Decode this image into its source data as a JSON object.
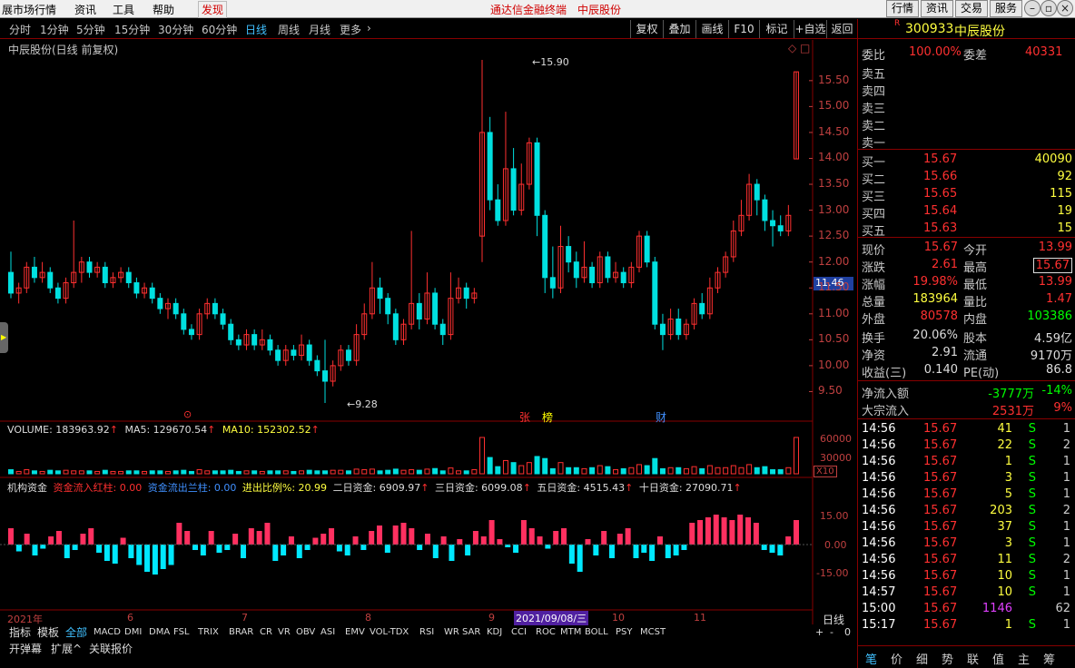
{
  "menu": {
    "market": "展市场行情",
    "info": "资讯",
    "tools": "工具",
    "help": "帮助",
    "discover": "发现",
    "title": "通达信金融终端",
    "stock": "中辰股份",
    "btns": [
      "行情",
      "资讯",
      "交易",
      "服务"
    ]
  },
  "periods": [
    "分时",
    "1分钟",
    "5分钟",
    "15分钟",
    "30分钟",
    "60分钟",
    "日线",
    "周线",
    "月线",
    "更多",
    "›"
  ],
  "tools": [
    "复权",
    "叠加",
    "画线",
    "F10",
    "标记",
    "+自选",
    "返回"
  ],
  "chart": {
    "title": "中辰股份(日线 前复权)",
    "high_label": "15.90",
    "low_label": "9.28",
    "cursor_price": "11.46",
    "ylabels": [
      "15.50",
      "15.00",
      "14.50",
      "14.00",
      "13.50",
      "13.00",
      "12.50",
      "12.00",
      "11.50",
      "11.00",
      "10.50",
      "10.00",
      "9.50"
    ],
    "markers": [
      {
        "t": "⊙",
        "c": "#ff3030"
      },
      {
        "t": "张",
        "c": "#ff3030"
      },
      {
        "t": "榜",
        "c": "#ffff00"
      },
      {
        "t": "财",
        "c": "#4090ff"
      }
    ]
  },
  "volume": {
    "label": "VOLUME: 183963.92",
    "ma5": "MA5: 129670.54",
    "ma10": "MA10: 152302.52",
    "y1": "60000",
    "y2": "30000",
    "unit": "X10"
  },
  "fund": {
    "label": "机构资金",
    "in": "资金流入红柱: 0.00",
    "out": "资金流出兰柱: 0.00",
    "ratio": "进出比例%: 20.99",
    "d2": "二日资金: 6909.97",
    "d3": "三日资金: 6099.08",
    "d5": "五日资金: 4515.43",
    "d10": "十日资金: 27090.71",
    "y1": "15.00",
    "y2": "0.00",
    "y3": "-15.00"
  },
  "xaxis": {
    "year": "2021年",
    "m6": "6",
    "m7": "7",
    "m8": "8",
    "m9": "9",
    "date": "2021/09/08/三",
    "m10": "10",
    "m11": "11",
    "period": "日线"
  },
  "indicators": [
    "指标",
    "模板",
    "全部",
    "MACD",
    "DMI",
    "DMA",
    "FSL",
    "TRIX",
    "BRAR",
    "CR",
    "VR",
    "OBV",
    "ASI",
    "EMV",
    "VOL-TDX",
    "RSI",
    "WR",
    "SAR",
    "KDJ",
    "CCI",
    "ROC",
    "MTM",
    "BOLL",
    "PSY",
    "MCST"
  ],
  "bottom2": [
    "开弹幕",
    "扩展^",
    "关联报价"
  ],
  "zoom": [
    "+",
    "-",
    "0"
  ],
  "quote": {
    "code": "300933",
    "name": "中辰股份",
    "wb": "委比",
    "wb_v": "100.00%",
    "wc": "委差",
    "wc_v": "40331",
    "sells": [
      "卖五",
      "卖四",
      "卖三",
      "卖二",
      "卖一"
    ],
    "buys": [
      {
        "l": "买一",
        "p": "15.67",
        "v": "40090"
      },
      {
        "l": "买二",
        "p": "15.66",
        "v": "92"
      },
      {
        "l": "买三",
        "p": "15.65",
        "v": "115"
      },
      {
        "l": "买四",
        "p": "15.64",
        "v": "19"
      },
      {
        "l": "买五",
        "p": "15.63",
        "v": "15"
      }
    ],
    "stats": [
      [
        "现价",
        "15.67",
        "今开",
        "13.99"
      ],
      [
        "涨跌",
        "2.61",
        "最高",
        "15.67"
      ],
      [
        "涨幅",
        "19.98%",
        "最低",
        "13.99"
      ],
      [
        "总量",
        "183964",
        "量比",
        "1.47"
      ],
      [
        "外盘",
        "80578",
        "内盘",
        "103386"
      ],
      [
        "换手",
        "20.06%",
        "股本",
        "4.59亿"
      ],
      [
        "净资",
        "2.91",
        "流通",
        "9170万"
      ],
      [
        "收益(三)",
        "0.140",
        "PE(动)",
        "86.8"
      ]
    ],
    "flow": [
      [
        "净流入额",
        "-3777万",
        "-14%"
      ],
      [
        "大宗流入",
        "2531万",
        "9%"
      ]
    ],
    "ticks": [
      [
        "14:56",
        "15.67",
        "41",
        "S",
        "1"
      ],
      [
        "14:56",
        "15.67",
        "22",
        "S",
        "2"
      ],
      [
        "14:56",
        "15.67",
        "1",
        "S",
        "1"
      ],
      [
        "14:56",
        "15.67",
        "3",
        "S",
        "1"
      ],
      [
        "14:56",
        "15.67",
        "5",
        "S",
        "1"
      ],
      [
        "14:56",
        "15.67",
        "203",
        "S",
        "2"
      ],
      [
        "14:56",
        "15.67",
        "37",
        "S",
        "1"
      ],
      [
        "14:56",
        "15.67",
        "3",
        "S",
        "1"
      ],
      [
        "14:56",
        "15.67",
        "11",
        "S",
        "2"
      ],
      [
        "14:56",
        "15.67",
        "10",
        "S",
        "1"
      ],
      [
        "14:57",
        "15.67",
        "10",
        "S",
        "1"
      ],
      [
        "15:00",
        "15.67",
        "1146",
        "",
        "62"
      ],
      [
        "15:17",
        "15.67",
        "1",
        "S",
        "1"
      ]
    ],
    "tabs": [
      "笔",
      "价",
      "细",
      "势",
      "联",
      "值",
      "主",
      "筹"
    ]
  },
  "candles": [
    [
      11.8,
      11.4,
      12.2,
      11.3
    ],
    [
      11.4,
      11.5,
      11.6,
      11.2
    ],
    [
      11.5,
      11.9,
      12.0,
      11.4
    ],
    [
      11.9,
      11.7,
      12.1,
      11.6
    ],
    [
      11.7,
      11.8,
      12.0,
      11.6
    ],
    [
      11.8,
      11.5,
      11.9,
      11.4
    ],
    [
      11.5,
      11.3,
      11.6,
      11.2
    ],
    [
      11.3,
      11.6,
      11.7,
      11.2
    ],
    [
      11.6,
      11.8,
      12.8,
      11.5
    ],
    [
      11.8,
      12.0,
      12.1,
      11.6
    ],
    [
      12.0,
      11.8,
      12.1,
      11.7
    ],
    [
      11.8,
      11.9,
      12.0,
      11.7
    ],
    [
      11.9,
      11.6,
      12.0,
      11.5
    ],
    [
      11.6,
      11.7,
      11.8,
      11.5
    ],
    [
      11.7,
      11.8,
      11.9,
      11.6
    ],
    [
      11.8,
      11.6,
      11.9,
      11.5
    ],
    [
      11.6,
      11.4,
      11.7,
      11.3
    ],
    [
      11.4,
      11.5,
      11.6,
      11.3
    ],
    [
      11.5,
      11.3,
      11.6,
      11.2
    ],
    [
      11.3,
      11.1,
      11.4,
      11.0
    ],
    [
      11.1,
      11.2,
      11.3,
      10.9
    ],
    [
      11.2,
      11.0,
      11.3,
      10.9
    ],
    [
      11.0,
      10.7,
      11.1,
      10.6
    ],
    [
      10.7,
      10.6,
      10.8,
      10.5
    ],
    [
      10.6,
      11.0,
      11.1,
      10.5
    ],
    [
      11.0,
      11.2,
      11.3,
      10.9
    ],
    [
      11.2,
      11.0,
      11.3,
      10.9
    ],
    [
      11.0,
      10.8,
      11.1,
      10.7
    ],
    [
      10.8,
      10.5,
      10.9,
      10.4
    ],
    [
      10.5,
      10.4,
      10.6,
      10.3
    ],
    [
      10.4,
      10.6,
      10.7,
      10.3
    ],
    [
      10.6,
      10.4,
      10.7,
      10.3
    ],
    [
      10.4,
      10.5,
      10.7,
      10.3
    ],
    [
      10.5,
      10.3,
      10.6,
      10.2
    ],
    [
      10.3,
      10.1,
      10.4,
      10.0
    ],
    [
      10.1,
      10.3,
      10.4,
      10.0
    ],
    [
      10.3,
      10.2,
      10.4,
      10.1
    ],
    [
      10.2,
      10.4,
      10.6,
      10.1
    ],
    [
      10.4,
      10.1,
      10.5,
      10.0
    ],
    [
      10.1,
      9.9,
      10.2,
      9.8
    ],
    [
      9.9,
      9.7,
      10.5,
      9.28
    ],
    [
      9.7,
      10.0,
      10.1,
      9.6
    ],
    [
      10.0,
      10.3,
      10.4,
      9.9
    ],
    [
      10.3,
      10.1,
      10.4,
      10.0
    ],
    [
      10.1,
      10.6,
      10.8,
      10.0
    ],
    [
      10.6,
      11.0,
      11.2,
      10.5
    ],
    [
      11.0,
      11.5,
      12.0,
      10.9
    ],
    [
      11.5,
      11.3,
      11.7,
      11.0
    ],
    [
      11.3,
      11.0,
      11.4,
      10.8
    ],
    [
      11.0,
      10.5,
      11.1,
      10.4
    ],
    [
      10.5,
      10.8,
      10.9,
      10.4
    ],
    [
      10.8,
      11.2,
      12.6,
      10.7
    ],
    [
      11.2,
      10.9,
      11.4,
      10.7
    ],
    [
      10.9,
      11.4,
      11.8,
      10.8
    ],
    [
      11.4,
      10.8,
      11.5,
      10.7
    ],
    [
      10.8,
      10.6,
      10.9,
      10.4
    ],
    [
      10.6,
      11.3,
      11.8,
      10.5
    ],
    [
      11.3,
      11.5,
      11.7,
      11.2
    ],
    [
      11.5,
      11.3,
      11.6,
      11.1
    ],
    [
      11.3,
      11.4,
      11.5,
      11.2
    ],
    [
      12.5,
      14.5,
      15.9,
      12.0
    ],
    [
      14.5,
      13.2,
      14.8,
      13.0
    ],
    [
      13.2,
      12.8,
      13.5,
      12.7
    ],
    [
      12.8,
      13.8,
      14.9,
      12.7
    ],
    [
      13.8,
      13.0,
      14.2,
      12.9
    ],
    [
      13.0,
      13.5,
      13.9,
      12.9
    ],
    [
      13.5,
      14.3,
      14.4,
      13.4
    ],
    [
      14.3,
      12.9,
      14.4,
      12.5
    ],
    [
      12.9,
      11.7,
      13.0,
      11.4
    ],
    [
      11.7,
      11.5,
      12.3,
      11.3
    ],
    [
      11.5,
      12.3,
      12.7,
      11.4
    ],
    [
      12.3,
      12.0,
      12.5,
      11.8
    ],
    [
      12.0,
      11.7,
      12.2,
      11.5
    ],
    [
      11.7,
      11.9,
      12.4,
      11.6
    ],
    [
      11.9,
      11.6,
      12.0,
      11.5
    ],
    [
      11.6,
      12.1,
      12.2,
      11.5
    ],
    [
      12.1,
      11.7,
      12.2,
      11.6
    ],
    [
      11.7,
      11.8,
      12.0,
      11.6
    ],
    [
      11.8,
      11.6,
      11.9,
      11.5
    ],
    [
      11.6,
      11.9,
      12.0,
      11.5
    ],
    [
      11.9,
      12.5,
      12.6,
      11.8
    ],
    [
      12.5,
      12.0,
      12.6,
      11.9
    ],
    [
      12.0,
      10.8,
      12.1,
      10.7
    ],
    [
      10.8,
      10.6,
      11.0,
      10.3
    ],
    [
      10.6,
      10.9,
      11.1,
      10.5
    ],
    [
      10.9,
      10.6,
      11.1,
      10.5
    ],
    [
      10.6,
      10.8,
      10.9,
      10.5
    ],
    [
      10.8,
      11.2,
      11.3,
      10.7
    ],
    [
      11.2,
      11.0,
      11.4,
      10.9
    ],
    [
      11.0,
      11.5,
      11.7,
      10.9
    ],
    [
      11.5,
      11.8,
      11.9,
      11.4
    ],
    [
      11.8,
      12.1,
      12.2,
      11.7
    ],
    [
      12.1,
      12.6,
      12.8,
      12.0
    ],
    [
      12.6,
      12.9,
      13.2,
      12.5
    ],
    [
      12.9,
      13.5,
      13.7,
      12.8
    ],
    [
      13.5,
      13.2,
      13.6,
      12.9
    ],
    [
      13.2,
      12.8,
      13.3,
      12.6
    ],
    [
      12.8,
      12.7,
      13.0,
      12.3
    ],
    [
      12.7,
      12.6,
      12.9,
      12.5
    ],
    [
      12.6,
      12.9,
      13.1,
      12.5
    ],
    [
      13.99,
      15.67,
      15.67,
      13.99
    ]
  ],
  "funds": [
    12,
    -5,
    8,
    -8,
    -3,
    6,
    10,
    -10,
    -4,
    8,
    12,
    -6,
    -12,
    -14,
    5,
    -10,
    -15,
    -20,
    -22,
    -18,
    -15,
    16,
    10,
    -4,
    -8,
    10,
    -6,
    -4,
    8,
    -10,
    12,
    10,
    16,
    -12,
    -8,
    6,
    -10,
    -4,
    5,
    8,
    12,
    -5,
    -8,
    6,
    -4,
    10,
    14,
    -6,
    14,
    16,
    12,
    -4,
    8,
    -10,
    6,
    -12,
    4,
    -8,
    10,
    6,
    18,
    4,
    -2,
    -6,
    18,
    12,
    6,
    -3,
    10,
    12,
    -14,
    -20,
    4,
    -8,
    10,
    -10,
    8,
    12,
    -10,
    -6,
    -12,
    6,
    -10,
    -8,
    -4,
    16,
    18,
    20,
    22,
    20,
    18,
    22,
    20,
    16,
    -4,
    -6,
    -8,
    6,
    18
  ]
}
